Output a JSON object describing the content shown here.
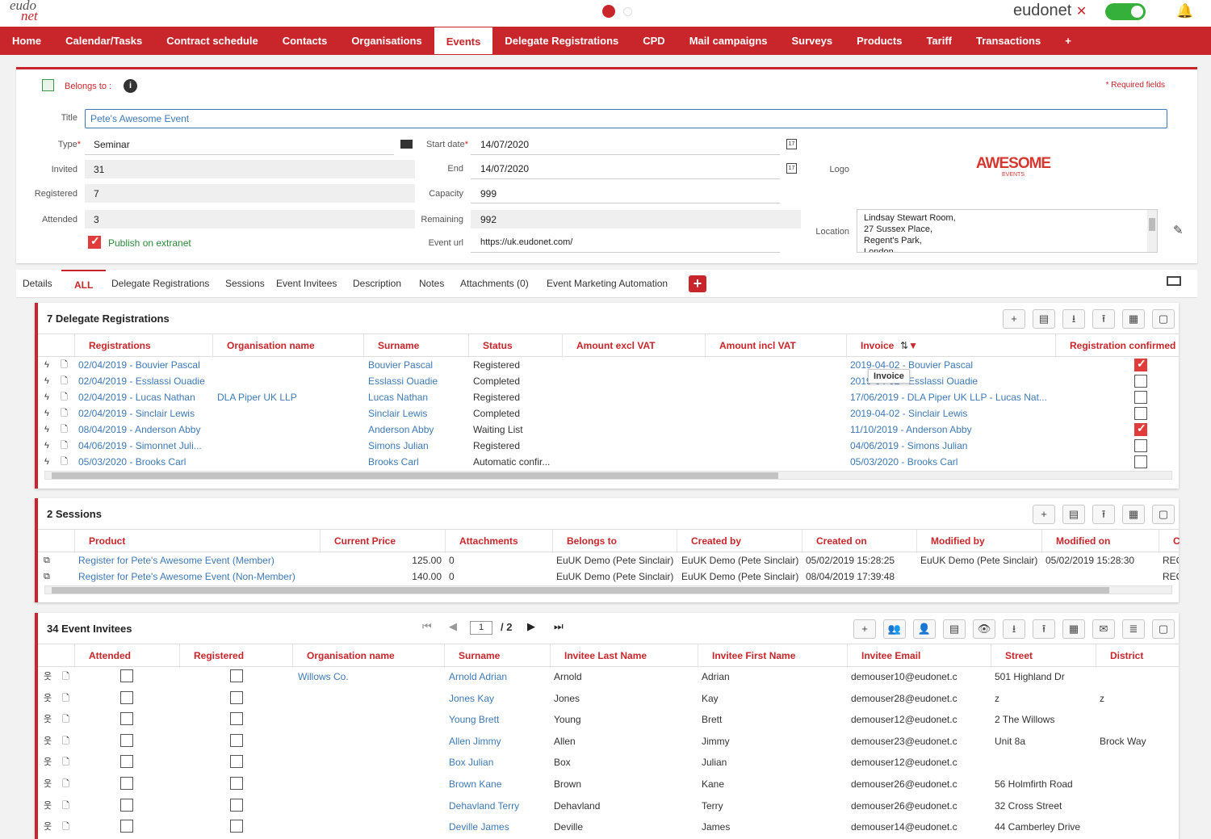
{
  "app": {
    "logo_top": "eudo",
    "logo_bottom": "net",
    "brand": "eudonet"
  },
  "nav": [
    "Home",
    "Calendar/Tasks",
    "Contract schedule",
    "Contacts",
    "Organisations",
    "Events",
    "Delegate Registrations",
    "CPD",
    "Mail campaigns",
    "Surveys",
    "Products",
    "Tariff",
    "Transactions",
    "+"
  ],
  "form": {
    "belongs_label": "Belongs to :",
    "required": "* Required fields",
    "title_label": "Title",
    "title_value": "Pete's Awesome Event",
    "type_label": "Type",
    "type_value": "Seminar",
    "invited_label": "Invited",
    "invited_value": "31",
    "registered_label": "Registered",
    "registered_value": "7",
    "attended_label": "Attended",
    "attended_value": "3",
    "publish_label": "Publish on extranet",
    "start_label": "Start date",
    "start_value": "14/07/2020",
    "end_label": "End",
    "end_value": "14/07/2020",
    "capacity_label": "Capacity",
    "capacity_value": "999",
    "remaining_label": "Remaining",
    "remaining_value": "992",
    "url_label": "Event url",
    "url_value": "https://uk.eudonet.com/",
    "logo_label": "Logo",
    "logo_text": "AWESOME",
    "logo_sub": "EVENTS",
    "location_label": "Location",
    "location_lines": [
      "Lindsay Stewart Room,",
      "27 Sussex Place,",
      "Regent's Park,",
      "London"
    ]
  },
  "tabs": [
    "Details",
    "ALL",
    "Delegate Registrations",
    "Sessions",
    "Event Invitees",
    "Description",
    "Notes",
    "Attachments (0)",
    "Event Marketing Automation"
  ],
  "reg": {
    "title": "7 Delegate Registrations",
    "headers": [
      "Registrations",
      "Organisation name",
      "Surname",
      "Status",
      "Amount excl VAT",
      "Amount incl VAT",
      "Invoice",
      "Registration confirmed"
    ],
    "tooltip": "Invoice",
    "rows": [
      {
        "r": "02/04/2019 - Bouvier Pascal",
        "o": "",
        "s": "Bouvier Pascal",
        "st": "Registered",
        "inv": "2019-04-02 - Bouvier Pascal",
        "c": true
      },
      {
        "r": "02/04/2019 - Esslassi Ouadie",
        "o": "",
        "s": "Esslassi Ouadie",
        "st": "Completed",
        "inv": "2019-04-02 - Esslassi Ouadie",
        "c": false
      },
      {
        "r": "02/04/2019 - Lucas Nathan",
        "o": "DLA Piper UK LLP",
        "s": "Lucas Nathan",
        "st": "Registered",
        "inv": "17/06/2019 - DLA Piper UK LLP - Lucas Nat...",
        "c": false
      },
      {
        "r": "02/04/2019 - Sinclair Lewis",
        "o": "",
        "s": "Sinclair Lewis",
        "st": "Completed",
        "inv": "2019-04-02 - Sinclair Lewis",
        "c": false
      },
      {
        "r": "08/04/2019 - Anderson Abby",
        "o": "",
        "s": "Anderson Abby",
        "st": "Waiting List",
        "inv": "11/10/2019 - Anderson Abby",
        "c": true
      },
      {
        "r": "04/06/2019 - Simonnet Juli...",
        "o": "",
        "s": "Simons Julian",
        "st": "Registered",
        "inv": "04/06/2019 - Simons Julian",
        "c": false
      },
      {
        "r": "05/03/2020 - Brooks Carl",
        "o": "",
        "s": "Brooks Carl",
        "st": "Automatic confir...",
        "inv": "05/03/2020 - Brooks Carl",
        "c": false
      }
    ]
  },
  "sessions": {
    "title": "2 Sessions",
    "headers": [
      "Product",
      "Current Price",
      "Attachments",
      "Belongs to",
      "Created by",
      "Created on",
      "Modified by",
      "Modified on",
      "C"
    ],
    "rows": [
      {
        "p": "Register for Pete's Awesome Event (Member)",
        "price": "125.00",
        "att": "0",
        "b": "EuUK Demo (Pete Sinclair)",
        "cb": "EuUK Demo (Pete Sinclair)",
        "co": "05/02/2019 15:28:25",
        "mb": "EuUK Demo (Pete Sinclair)",
        "mo": "05/02/2019 15:28:30",
        "x": "REC"
      },
      {
        "p": "Register for Pete's Awesome Event (Non-Member)",
        "price": "140.00",
        "att": "0",
        "b": "EuUK Demo (Pete Sinclair)",
        "cb": "EuUK Demo (Pete Sinclair)",
        "co": "08/04/2019 17:39:48",
        "mb": "",
        "mo": "",
        "x": "REC"
      }
    ]
  },
  "invitees": {
    "title": "34 Event Invitees",
    "page": "1",
    "pages": "/ 2",
    "headers": [
      "Attended",
      "Registered",
      "Organisation name",
      "Surname",
      "Invitee Last Name",
      "Invitee First Name",
      "Invitee Email",
      "Street",
      "District"
    ],
    "rows": [
      {
        "o": "Willows Co.",
        "s": "Arnold Adrian",
        "l": "Arnold",
        "f": "Adrian",
        "e": "demouser10@eudonet.c",
        "st": "501 Highland Dr",
        "d": ""
      },
      {
        "o": "",
        "s": "Jones Kay",
        "l": "Jones",
        "f": "Kay",
        "e": "demouser28@eudonet.c",
        "st": "z",
        "d": "z"
      },
      {
        "o": "",
        "s": "Young Brett",
        "l": "Young",
        "f": "Brett",
        "e": "demouser12@eudonet.c",
        "st": "2 The Willows",
        "d": ""
      },
      {
        "o": "",
        "s": "Allen Jimmy",
        "l": "Allen",
        "f": "Jimmy",
        "e": "demouser23@eudonet.c",
        "st": "Unit 8a",
        "d": "Brock Way"
      },
      {
        "o": "",
        "s": "Box Julian",
        "l": "Box",
        "f": "Julian",
        "e": "demouser12@eudonet.c",
        "st": "",
        "d": ""
      },
      {
        "o": "",
        "s": "Brown Kane",
        "l": "Brown",
        "f": "Kane",
        "e": "demouser26@eudonet.c",
        "st": "56 Holmfirth Road",
        "d": ""
      },
      {
        "o": "",
        "s": "Dehavland Terry",
        "l": "Dehavland",
        "f": "Terry",
        "e": "demouser26@eudonet.c",
        "st": "32 Cross Street",
        "d": ""
      },
      {
        "o": "",
        "s": "Deville James",
        "l": "Deville",
        "f": "James",
        "e": "demouser14@eudonet.c",
        "st": "44 Camberley Drive",
        "d": ""
      }
    ]
  }
}
